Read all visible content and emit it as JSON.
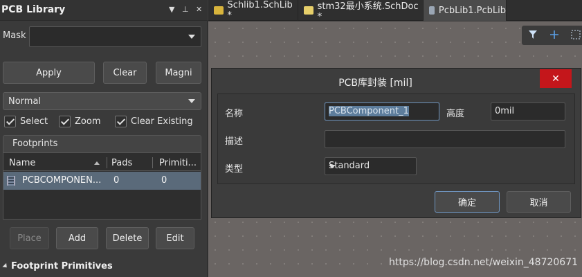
{
  "panel": {
    "title": "PCB Library",
    "controls": [
      "▼",
      "⊥",
      "✕"
    ],
    "mask_label": "Mask",
    "mask_value": "",
    "buttons": {
      "apply": "Apply",
      "clear": "Clear",
      "magni": "Magni"
    },
    "mode": "Normal",
    "checkboxes": [
      {
        "label": "Select",
        "checked": true
      },
      {
        "label": "Zoom",
        "checked": true
      },
      {
        "label": "Clear Existing",
        "checked": true
      }
    ],
    "footprints_header": "Footprints",
    "columns": [
      "Name",
      "Pads",
      "Primiti..."
    ],
    "rows": [
      {
        "name": "PCBCOMPONEN...",
        "pads": "0",
        "primitives": "0"
      }
    ],
    "actions": {
      "place": "Place",
      "add": "Add",
      "delete": "Delete",
      "edit": "Edit"
    },
    "primitives_header": "Footprint Primitives"
  },
  "tabs": [
    {
      "label": "Schlib1.SchLib *",
      "icon_color": "#d8b43c"
    },
    {
      "label": "stm32最小系统.SchDoc *",
      "icon_color": "#e7cf6a"
    },
    {
      "label": "PcbLib1.PcbLib",
      "icon_color": "#9aa6b4"
    }
  ],
  "toolbar": {
    "icons": [
      "filter-icon",
      "plus-icon",
      "select-rect-icon"
    ]
  },
  "dialog": {
    "title": "PCB库封装 [mil]",
    "close": "✕",
    "name_label": "名称",
    "name_value": "PCBComponent_1",
    "height_label": "高度",
    "height_value": "0mil",
    "desc_label": "描述",
    "desc_value": "",
    "type_label": "类型",
    "type_value": "Standard",
    "ok": "确定",
    "cancel": "取消"
  },
  "watermark": "https://blog.csdn.net/weixin_48720671"
}
